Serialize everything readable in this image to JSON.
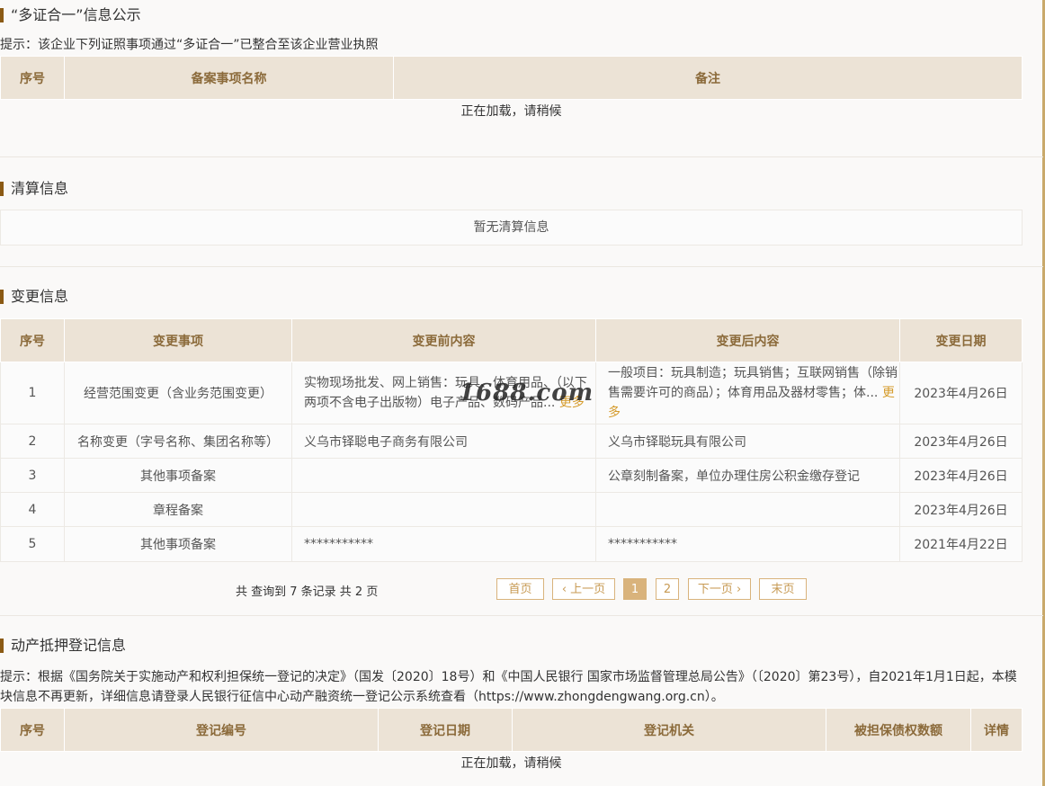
{
  "multi_cert": {
    "title": "“多证合一”信息公示",
    "tip": "提示：该企业下列证照事项通过“多证合一”已整合至该企业营业执照",
    "headers": [
      "序号",
      "备案事项名称",
      "备注"
    ],
    "loading": "正在加载，请稍候"
  },
  "liquidation": {
    "title": "清算信息",
    "empty": "暂无清算信息"
  },
  "changes": {
    "title": "变更信息",
    "headers": [
      "序号",
      "变更事项",
      "变更前内容",
      "变更后内容",
      "变更日期"
    ],
    "more_label": "更多",
    "rows": [
      {
        "no": "1",
        "item": "经营范围变更（含业务范围变更）",
        "before": "实物现场批发、网上销售：玩具、体育用品、（以下两项不含电子出版物）电子产品、数码产品...",
        "after": "一般项目：玩具制造；玩具销售；互联网销售（除销售需要许可的商品）；体育用品及器材零售；体...",
        "date": "2023年4月26日"
      },
      {
        "no": "2",
        "item": "名称变更（字号名称、集团名称等）",
        "before": "义乌市铎聪电子商务有限公司",
        "after": "义乌市铎聪玩具有限公司",
        "date": "2023年4月26日"
      },
      {
        "no": "3",
        "item": "其他事项备案",
        "before": "",
        "after": "公章刻制备案，单位办理住房公积金缴存登记",
        "date": "2023年4月26日"
      },
      {
        "no": "4",
        "item": "章程备案",
        "before": "",
        "after": "",
        "date": "2023年4月26日"
      },
      {
        "no": "5",
        "item": "其他事项备案",
        "before": "***********",
        "after": "***********",
        "date": "2021年4月22日"
      }
    ],
    "pager": {
      "summary": "共 查询到 7 条记录 共 2 页",
      "first": "首页",
      "prev": "上一页",
      "page1": "1",
      "page2": "2",
      "next": "下一页",
      "last": "末页"
    }
  },
  "pledge": {
    "title": "动产抵押登记信息",
    "tip": "提示：根据《国务院关于实施动产和权利担保统一登记的决定》（国发〔2020〕18号）和《中国人民银行 国家市场监督管理总局公告》（〔2020〕第23号），自2021年1月1日起，本模块信息不再更新，详细信息请登录人民银行征信中心动产融资统一登记公示系统查看（https://www.zhongdengwang.org.cn）。",
    "headers": [
      "序号",
      "登记编号",
      "登记日期",
      "登记机关",
      "被担保债权数额",
      "详情"
    ],
    "loading": "正在加载，请稍候"
  },
  "watermark": "1688.com"
}
